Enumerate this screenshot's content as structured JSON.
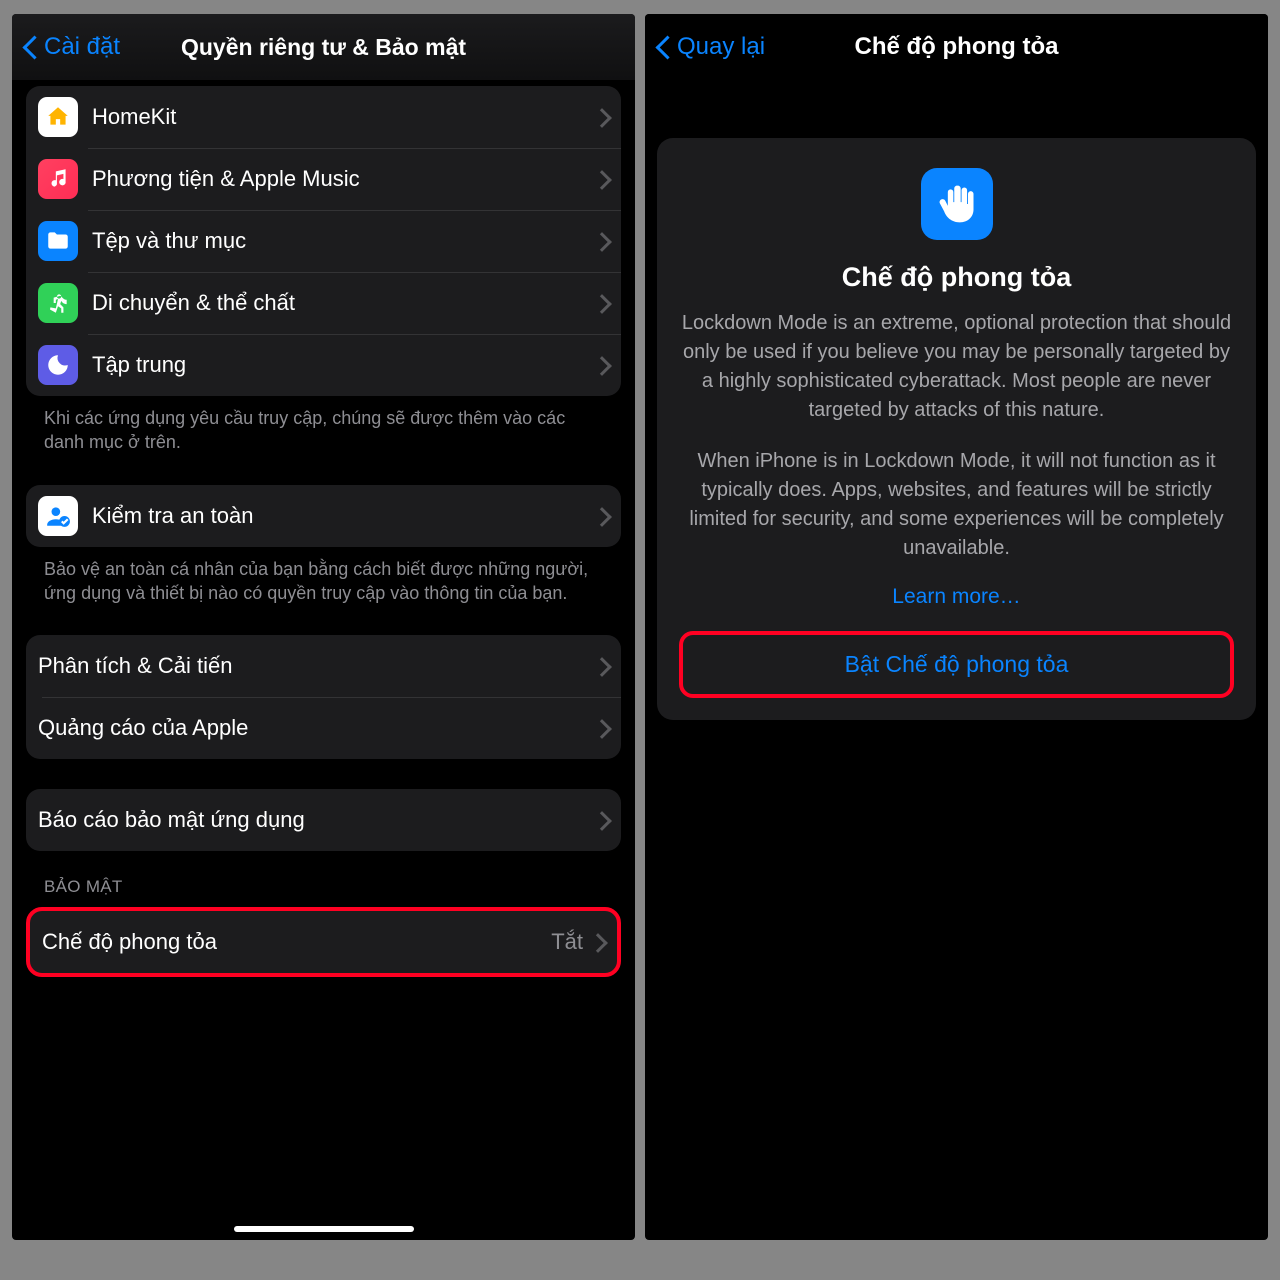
{
  "left": {
    "nav": {
      "back": "Cài đặt",
      "title": "Quyền riêng tư & Bảo mật"
    },
    "group1": [
      {
        "label": "HomeKit"
      },
      {
        "label": "Phương tiện & Apple Music"
      },
      {
        "label": "Tệp và thư mục"
      },
      {
        "label": "Di chuyển & thể chất"
      },
      {
        "label": "Tập trung"
      }
    ],
    "foot1": "Khi các ứng dụng yêu cầu truy cập, chúng sẽ được thêm vào các danh mục ở trên.",
    "safety": {
      "label": "Kiểm tra an toàn"
    },
    "foot2": "Bảo vệ an toàn cá nhân của bạn bằng cách biết được những người, ứng dụng và thiết bị nào có quyền truy cập vào thông tin của bạn.",
    "group3": [
      {
        "label": "Phân tích & Cải tiến"
      },
      {
        "label": "Quảng cáo của Apple"
      }
    ],
    "group4": [
      {
        "label": "Báo cáo bảo mật ứng dụng"
      }
    ],
    "section5": "BẢO MẬT",
    "lockdown": {
      "label": "Chế độ phong tỏa",
      "value": "Tắt"
    }
  },
  "right": {
    "nav": {
      "back": "Quay lại",
      "title": "Chế độ phong tỏa"
    },
    "card": {
      "title": "Chế độ phong tỏa",
      "p1": "Lockdown Mode is an extreme, optional protection that should only be used if you believe you may be personally targeted by a highly sophisticated cyberattack. Most people are never targeted by attacks of this nature.",
      "p2": "When iPhone is in Lockdown Mode, it will not function as it typically does. Apps, websites, and features will be strictly limited for security, and some experiences will be completely unavailable.",
      "learn": "Learn more…",
      "cta": "Bật Chế độ phong tỏa"
    }
  }
}
